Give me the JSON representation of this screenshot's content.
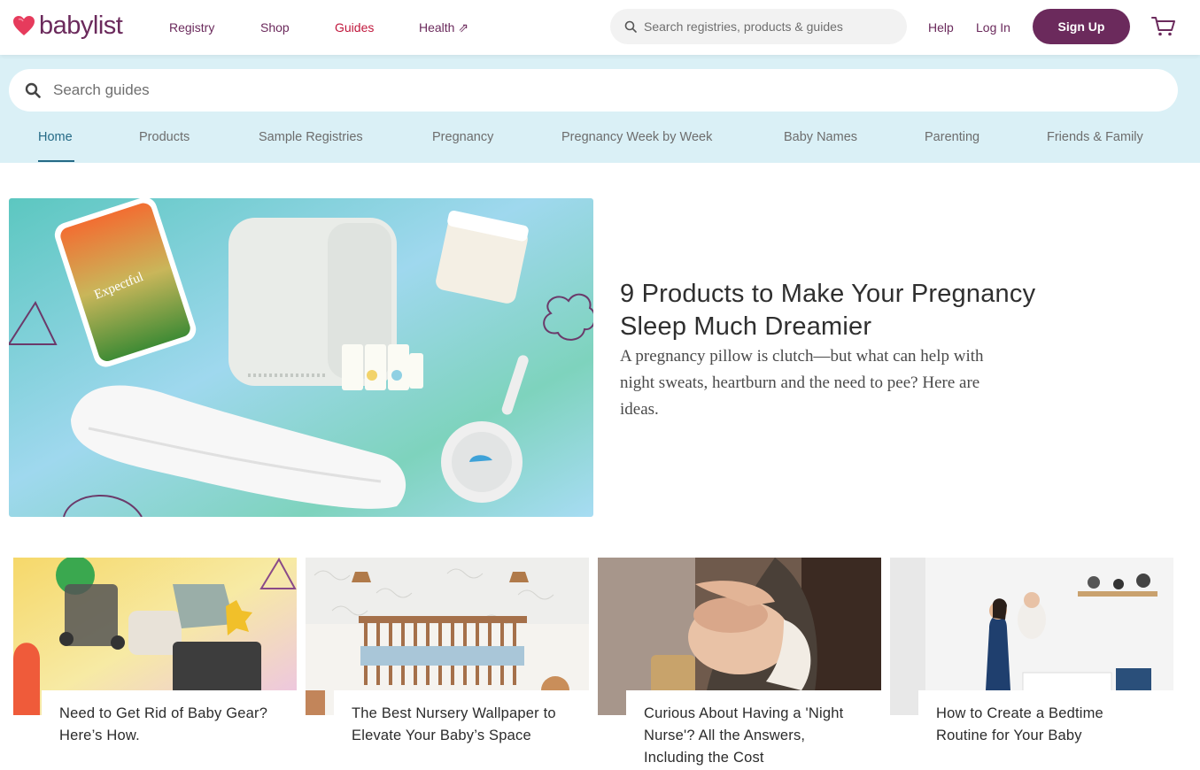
{
  "header": {
    "logo_text": "babylist",
    "nav": [
      {
        "label": "Registry"
      },
      {
        "label": "Shop"
      },
      {
        "label": "Guides"
      },
      {
        "label": "Health ⇗"
      }
    ],
    "search_placeholder": "Search registries, products & guides",
    "help_label": "Help",
    "login_label": "Log In",
    "signup_label": "Sign Up"
  },
  "guides": {
    "search_placeholder": "Search guides",
    "tabs": [
      {
        "label": "Home"
      },
      {
        "label": "Products"
      },
      {
        "label": "Sample Registries"
      },
      {
        "label": "Pregnancy"
      },
      {
        "label": "Pregnancy Week by Week"
      },
      {
        "label": "Baby Names"
      },
      {
        "label": "Parenting"
      },
      {
        "label": "Friends & Family"
      }
    ]
  },
  "hero": {
    "phone_brand": "Expectful",
    "title": "9 Products to Make Your Pregnancy Sleep Much Dreamier",
    "description": "A pregnancy pillow is clutch—but what can help with night sweats, heartburn and the need to pee? Here are ideas."
  },
  "cards": [
    {
      "title": "Need to Get Rid of Baby Gear? Here’s How."
    },
    {
      "title": "The Best Nursery Wallpaper to Elevate Your Baby’s Space"
    },
    {
      "title": "Curious About Having a 'Night Nurse'? All the Answers, Including the Cost"
    },
    {
      "title": "How to Create a Bedtime Routine for Your Baby"
    }
  ],
  "colors": {
    "brand_plum": "#6b2a5c",
    "guides_active_red": "#c0173c",
    "band_blue": "#daf0f6",
    "tab_active": "#256a86"
  }
}
